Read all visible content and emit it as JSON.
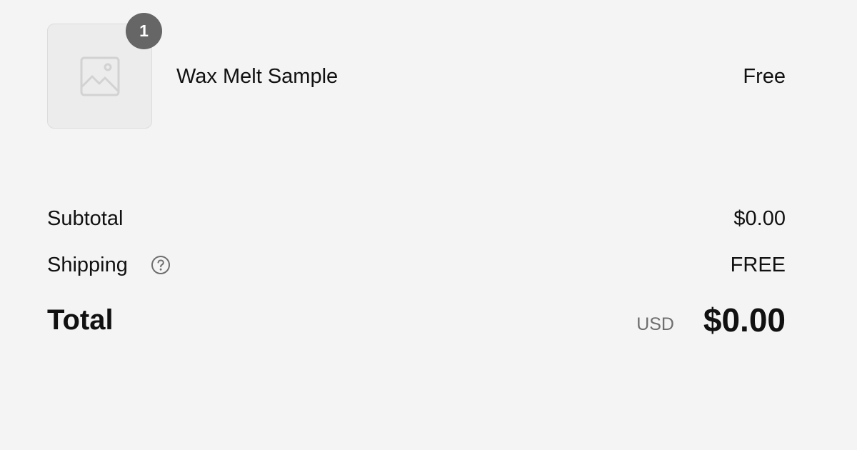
{
  "line_item": {
    "quantity": "1",
    "name": "Wax Melt Sample",
    "price": "Free",
    "image_icon": "image-placeholder-icon"
  },
  "summary": {
    "subtotal_label": "Subtotal",
    "subtotal_value": "$0.00",
    "shipping_label": "Shipping",
    "shipping_help_icon": "question-circle-icon",
    "shipping_value": "FREE",
    "total_label": "Total",
    "currency": "USD",
    "total_value": "$0.00"
  },
  "colors": {
    "background": "#f4f4f4",
    "text": "#111111",
    "badge": "#666666",
    "muted": "#6e6e6e"
  }
}
